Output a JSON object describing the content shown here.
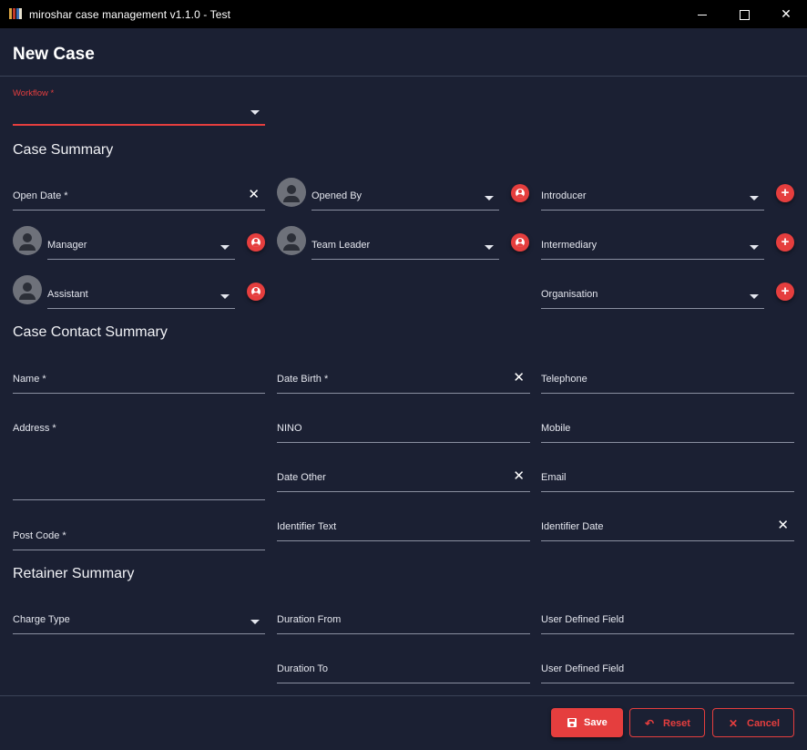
{
  "window": {
    "title": "miroshar case management v1.1.0 - Test"
  },
  "page": {
    "title": "New Case"
  },
  "workflow": {
    "label": "Workflow *"
  },
  "sections": {
    "case_summary": "Case Summary",
    "case_contact_summary": "Case Contact Summary",
    "retainer_summary": "Retainer Summary"
  },
  "case_summary": {
    "open_date": "Open Date *",
    "opened_by": "Opened By",
    "introducer": "Introducer",
    "manager": "Manager",
    "team_leader": "Team Leader",
    "intermediary": "Intermediary",
    "assistant": "Assistant",
    "organisation": "Organisation"
  },
  "contact": {
    "name": "Name *",
    "date_birth": "Date Birth *",
    "telephone": "Telephone",
    "address": "Address *",
    "nino": "NINO",
    "mobile": "Mobile",
    "date_other": "Date Other",
    "email": "Email",
    "post_code": "Post Code *",
    "identifier_text": "Identifier Text",
    "identifier_date": "Identifier Date"
  },
  "retainer": {
    "charge_type": "Charge Type",
    "duration_from": "Duration From",
    "user_defined_field_1": "User Defined Field",
    "duration_to": "Duration To",
    "user_defined_field_2": "User Defined Field"
  },
  "buttons": {
    "save": "Save",
    "reset": "Reset",
    "cancel": "Cancel"
  },
  "icons": {
    "app": "books-icon",
    "minimize": "minimize-icon",
    "maximize": "maximize-icon",
    "close": "close-icon",
    "dropdown": "caret-down-icon",
    "clear": "clear-icon",
    "avatar": "person-avatar-icon",
    "select_person": "person-badge-icon",
    "add": "plus-icon",
    "save": "floppy-disk-icon",
    "reset": "undo-icon",
    "cancel": "x-icon"
  },
  "colors": {
    "accent": "#e53e3e",
    "background": "#1b2033",
    "titlebar": "#000000"
  }
}
